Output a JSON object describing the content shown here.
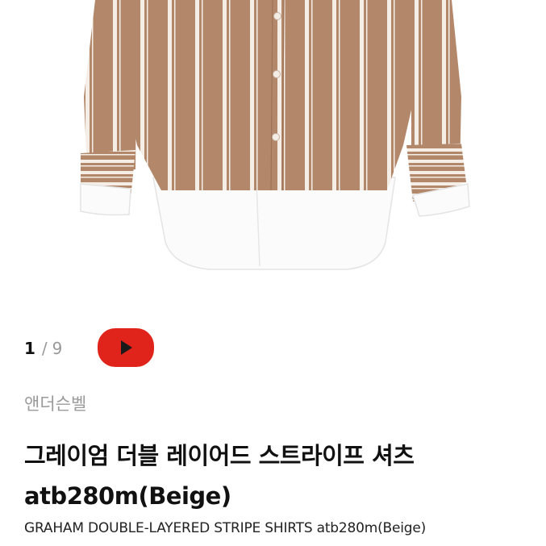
{
  "gallery": {
    "current": "1",
    "separator": "/",
    "total": "9",
    "image_alt_icon": "shirt-photo",
    "colors": {
      "fabric": "#b3876a",
      "stripe": "#ffffff",
      "play": "#e0241b"
    }
  },
  "video": {
    "icon": "play-icon"
  },
  "product": {
    "brand": "앤더슨벨",
    "title": "그레이엄 더블 레이어드 스트라이프 셔츠 atb280m(Beige)",
    "subtitle": "GRAHAM DOUBLE-LAYERED STRIPE SHIRTS atb280m(Beige)"
  }
}
